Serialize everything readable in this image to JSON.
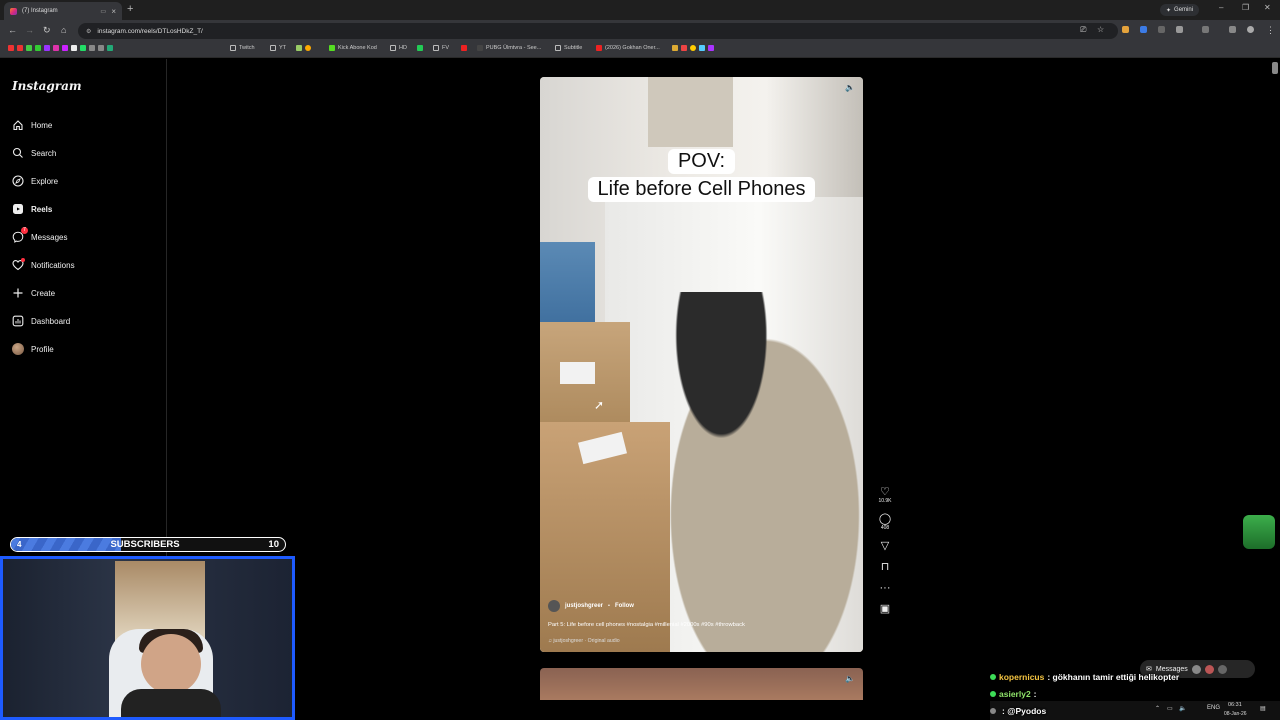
{
  "browser": {
    "tab_title": "(7) Instagram",
    "new_tab": "+",
    "url": "instagram.com/reels/DTLosHDkZ_T/",
    "gemini_label": "Gemini",
    "bookmarks": [
      "Twitch",
      "YT",
      "Kick Abone Kod",
      "HD",
      "FV",
      "PUBG Ülmtvra - See...",
      "Subtitle",
      "(2026) Gokhan Oner..."
    ]
  },
  "sidebar": {
    "logo": "Instagram",
    "items": [
      {
        "label": "Home",
        "icon": "home-icon"
      },
      {
        "label": "Search",
        "icon": "search-icon"
      },
      {
        "label": "Explore",
        "icon": "compass-icon"
      },
      {
        "label": "Reels",
        "icon": "reels-icon"
      },
      {
        "label": "Messages",
        "icon": "messenger-icon",
        "badge": "7"
      },
      {
        "label": "Notifications",
        "icon": "heart-icon"
      },
      {
        "label": "Create",
        "icon": "plus-icon"
      },
      {
        "label": "Dashboard",
        "icon": "dashboard-icon"
      },
      {
        "label": "Profile",
        "icon": "avatar"
      }
    ]
  },
  "reel": {
    "overlay_line1": "POV:",
    "overlay_line2": "Life before Cell Phones",
    "username": "justjoshgreer",
    "separator": "•",
    "follow": "Follow",
    "caption": "Part 5: Life before cell phones #nostalgia #millenial #2000s #90s #throwback",
    "audio": "justjoshgreer · Original audio",
    "likes": "10.9K",
    "comments": "408"
  },
  "stream_overlay": {
    "sub_current": "4",
    "sub_title": "SUBSCRIBERS",
    "sub_goal": "10",
    "sub_progress": 0.4
  },
  "chat": [
    {
      "user": "kopernicus",
      "message": ": gökhanın tamir ettiği helikopter",
      "color": "#f5c542"
    },
    {
      "user": "asierly2",
      "message": ":",
      "color": "#8fe36a"
    },
    {
      "user": "",
      "message": ": @Pyodos",
      "color": "#e0404a"
    }
  ],
  "messages_pill": {
    "label": "Messages",
    "badge": "7"
  },
  "taskbar": {
    "lang": "ENG",
    "time": "06:31",
    "date": "08-Jan-26"
  }
}
